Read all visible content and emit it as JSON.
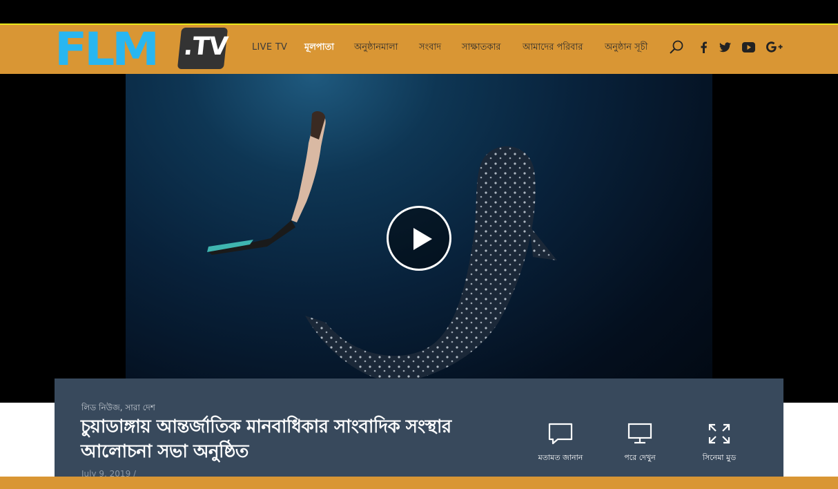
{
  "brand": {
    "logo_text": "FLM",
    "logo_suffix": ".TV",
    "primary_color": "#29b6f0",
    "header_color": "#d99634"
  },
  "nav": {
    "items": [
      {
        "label": "LIVE TV"
      },
      {
        "label": "মূলপাতা",
        "active": true
      },
      {
        "label": "অনুষ্ঠানমালা"
      },
      {
        "label": "সংবাদ"
      },
      {
        "label": "সাক্ষাতকার"
      },
      {
        "label": "আমাদের পরিবার"
      },
      {
        "label": "অনুষ্ঠান সূচী"
      }
    ],
    "search_icon": "search-icon",
    "social": [
      "facebook-icon",
      "twitter-icon",
      "youtube-icon",
      "google-plus-icon"
    ]
  },
  "video": {
    "play_icon": "play-icon"
  },
  "article": {
    "category": "লিড নিউজ, সারা দেশ",
    "title": "চুয়াডাঙ্গায় আন্তর্জাতিক মানবাধিকার সাংবাদিক সংস্থার আলোচনা সভা অনুষ্ঠিত",
    "date": "July 9, 2019 /"
  },
  "actions": [
    {
      "label": "মতামত জানান",
      "icon": "comment-icon"
    },
    {
      "label": "পরে দেখুন",
      "icon": "monitor-icon"
    },
    {
      "label": "সিনেমা মুড",
      "icon": "expand-icon"
    }
  ]
}
